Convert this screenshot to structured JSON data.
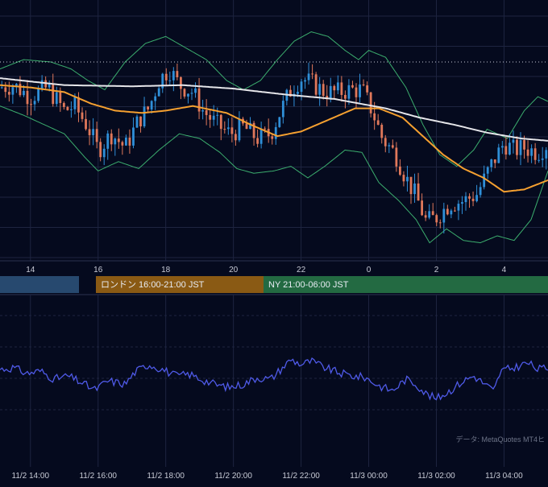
{
  "colors": {
    "background": "#050a1e",
    "grid": "#1e2440",
    "candle_up": "#2f8fd8",
    "candle_down": "#e0785a",
    "ma_short": "#f5a030",
    "ma_long": "#e6e6ea",
    "bollinger": "#3cae6e",
    "oscillator": "#4f5ae8",
    "session_tokyo": "#27496f",
    "session_london": "#8a5a14",
    "session_ny": "#236a42"
  },
  "sessions": [
    {
      "label": "",
      "color": "#27496f"
    },
    {
      "label": "ロンドン 16:00-21:00 JST",
      "color": "#8a5a14"
    },
    {
      "label": "NY 21:00-06:00 JST",
      "color": "#236a42"
    }
  ],
  "source_text": "データ: MetaQuotes MT4ヒ",
  "chart_data": [
    {
      "type": "candlestick",
      "x_tick_labels": [
        "14",
        "16",
        "18",
        "20",
        "22",
        "0",
        "2",
        "4"
      ],
      "x_tick_hours": [
        14,
        16,
        18,
        20,
        22,
        24,
        26,
        28
      ],
      "x_range_hours": [
        13.1,
        29.3
      ],
      "y_range": [
        0,
        100
      ],
      "grid": true,
      "reference_line_y": 83,
      "anchors": [
        [
          13.1,
          72
        ],
        [
          13.5,
          73
        ],
        [
          14.0,
          68
        ],
        [
          14.5,
          72
        ],
        [
          15.0,
          62
        ],
        [
          15.3,
          64
        ],
        [
          15.7,
          55
        ],
        [
          16.0,
          45
        ],
        [
          16.4,
          52
        ],
        [
          16.8,
          46
        ],
        [
          17.2,
          58
        ],
        [
          17.5,
          63
        ],
        [
          17.8,
          75
        ],
        [
          18.1,
          80
        ],
        [
          18.4,
          73
        ],
        [
          18.8,
          70
        ],
        [
          19.1,
          62
        ],
        [
          19.5,
          56
        ],
        [
          19.9,
          52
        ],
        [
          20.3,
          55
        ],
        [
          20.7,
          50
        ],
        [
          21.1,
          52
        ],
        [
          21.4,
          62
        ],
        [
          21.7,
          71
        ],
        [
          22.0,
          76
        ],
        [
          22.3,
          74
        ],
        [
          22.7,
          70
        ],
        [
          23.1,
          70
        ],
        [
          23.5,
          71
        ],
        [
          23.8,
          71
        ],
        [
          24.1,
          62
        ],
        [
          24.4,
          50
        ],
        [
          24.8,
          43
        ],
        [
          25.1,
          33
        ],
        [
          25.4,
          25
        ],
        [
          25.7,
          14
        ],
        [
          26.0,
          16
        ],
        [
          26.4,
          22
        ],
        [
          26.8,
          23
        ],
        [
          27.2,
          26
        ],
        [
          27.6,
          38
        ],
        [
          28.0,
          48
        ],
        [
          28.3,
          45
        ],
        [
          28.6,
          46
        ],
        [
          29.0,
          44
        ],
        [
          29.3,
          48
        ]
      ],
      "ma_long": [
        [
          13.1,
          76
        ],
        [
          15.0,
          73
        ],
        [
          17.0,
          72.5
        ],
        [
          18.5,
          73
        ],
        [
          20.0,
          71.5
        ],
        [
          21.5,
          69
        ],
        [
          23.0,
          67
        ],
        [
          24.5,
          63
        ],
        [
          25.5,
          59
        ],
        [
          26.5,
          56
        ],
        [
          27.5,
          52.5
        ],
        [
          28.5,
          50
        ],
        [
          29.3,
          49
        ]
      ],
      "ma_short": [
        [
          13.1,
          73
        ],
        [
          14.0,
          72
        ],
        [
          15.0,
          70
        ],
        [
          15.8,
          65
        ],
        [
          16.5,
          62
        ],
        [
          17.3,
          61
        ],
        [
          18.0,
          62
        ],
        [
          18.8,
          64
        ],
        [
          19.8,
          61
        ],
        [
          20.5,
          56
        ],
        [
          21.3,
          51
        ],
        [
          22.0,
          53
        ],
        [
          22.8,
          58
        ],
        [
          23.6,
          63
        ],
        [
          24.3,
          63
        ],
        [
          25.0,
          59
        ],
        [
          25.6,
          51
        ],
        [
          26.2,
          43
        ],
        [
          26.8,
          37
        ],
        [
          27.4,
          33
        ],
        [
          28.0,
          27
        ],
        [
          28.6,
          28
        ],
        [
          29.3,
          32
        ]
      ],
      "bollinger_upper": [
        [
          13.1,
          80
        ],
        [
          13.8,
          84
        ],
        [
          14.6,
          83
        ],
        [
          15.2,
          80
        ],
        [
          15.7,
          75
        ],
        [
          16.2,
          71
        ],
        [
          16.8,
          83
        ],
        [
          17.4,
          91
        ],
        [
          18.0,
          94
        ],
        [
          18.6,
          89
        ],
        [
          19.2,
          84
        ],
        [
          19.8,
          75
        ],
        [
          20.3,
          71
        ],
        [
          20.8,
          75
        ],
        [
          21.3,
          84
        ],
        [
          21.8,
          92
        ],
        [
          22.3,
          96
        ],
        [
          22.8,
          94
        ],
        [
          23.3,
          88
        ],
        [
          23.7,
          84
        ],
        [
          24.0,
          88
        ],
        [
          24.5,
          85
        ],
        [
          25.1,
          72
        ],
        [
          25.6,
          56
        ],
        [
          26.1,
          43
        ],
        [
          26.6,
          38
        ],
        [
          27.1,
          45
        ],
        [
          27.5,
          54
        ],
        [
          28.1,
          50
        ],
        [
          28.6,
          62
        ],
        [
          29.0,
          68
        ],
        [
          29.3,
          66
        ]
      ],
      "bollinger_lower": [
        [
          13.1,
          64
        ],
        [
          13.8,
          60
        ],
        [
          14.4,
          56
        ],
        [
          15.0,
          52
        ],
        [
          15.6,
          42
        ],
        [
          16.0,
          36
        ],
        [
          16.6,
          40
        ],
        [
          17.2,
          37
        ],
        [
          17.8,
          45
        ],
        [
          18.4,
          52
        ],
        [
          19.0,
          50
        ],
        [
          19.6,
          44
        ],
        [
          20.1,
          37
        ],
        [
          20.6,
          35
        ],
        [
          21.2,
          36
        ],
        [
          21.7,
          38
        ],
        [
          22.2,
          33
        ],
        [
          22.7,
          38
        ],
        [
          23.3,
          45
        ],
        [
          23.8,
          44
        ],
        [
          24.3,
          31
        ],
        [
          24.9,
          23
        ],
        [
          25.4,
          15
        ],
        [
          25.8,
          5
        ],
        [
          26.3,
          11
        ],
        [
          26.8,
          6
        ],
        [
          27.3,
          5
        ],
        [
          27.8,
          8
        ],
        [
          28.3,
          6
        ],
        [
          28.8,
          15
        ],
        [
          29.3,
          36
        ]
      ]
    },
    {
      "type": "line",
      "name": "",
      "x_tick_labels": [
        "11/2 14:00",
        "11/2 16:00",
        "11/2 18:00",
        "11/2 20:00",
        "11/2 22:00",
        "11/3 00:00",
        "11/3 02:00",
        "11/3 04:00"
      ],
      "x_range_hours": [
        13.1,
        29.3
      ],
      "y_range": [
        0,
        100
      ],
      "grid": true,
      "anchors": [
        [
          13.1,
          60
        ],
        [
          13.5,
          62
        ],
        [
          13.9,
          55
        ],
        [
          14.3,
          58
        ],
        [
          14.7,
          48
        ],
        [
          15.1,
          52
        ],
        [
          15.5,
          44
        ],
        [
          15.9,
          35
        ],
        [
          16.3,
          46
        ],
        [
          16.8,
          42
        ],
        [
          17.1,
          57
        ],
        [
          17.5,
          66
        ],
        [
          17.9,
          60
        ],
        [
          18.3,
          52
        ],
        [
          18.7,
          54
        ],
        [
          19.1,
          47
        ],
        [
          19.5,
          41
        ],
        [
          19.9,
          38
        ],
        [
          20.3,
          42
        ],
        [
          20.7,
          50
        ],
        [
          21.1,
          48
        ],
        [
          21.4,
          60
        ],
        [
          21.7,
          72
        ],
        [
          22.0,
          66
        ],
        [
          22.3,
          70
        ],
        [
          22.7,
          62
        ],
        [
          23.1,
          56
        ],
        [
          23.5,
          52
        ],
        [
          23.9,
          50
        ],
        [
          24.3,
          40
        ],
        [
          24.7,
          34
        ],
        [
          25.1,
          48
        ],
        [
          25.4,
          42
        ],
        [
          25.7,
          30
        ],
        [
          26.0,
          24
        ],
        [
          26.4,
          34
        ],
        [
          26.8,
          46
        ],
        [
          27.1,
          52
        ],
        [
          27.5,
          40
        ],
        [
          27.7,
          33
        ],
        [
          27.9,
          58
        ],
        [
          28.3,
          62
        ],
        [
          28.7,
          68
        ],
        [
          29.0,
          60
        ],
        [
          29.3,
          62
        ]
      ]
    }
  ]
}
